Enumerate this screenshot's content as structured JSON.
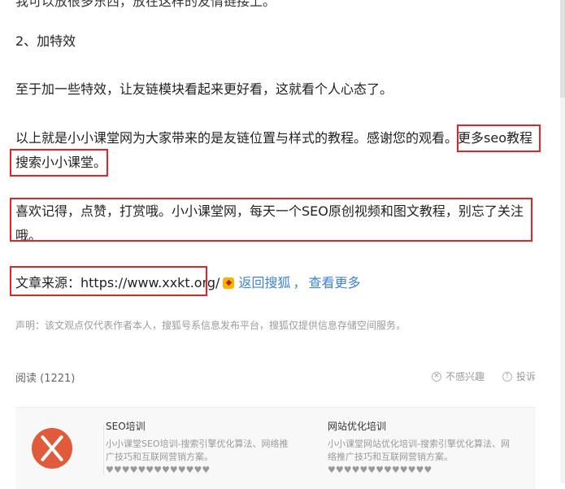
{
  "article": {
    "cut_text": "我可以放很多东西，放在这样的友情链接上。",
    "section_heading": "2、加特效",
    "para_effects": "至于加一些特效，让友链模块看起来更好看，这就看个人心态了。",
    "para_thanks_main": "以上就是小小课堂网为大家带来的是友链位置与样式的教程。感谢您的观看。",
    "para_thanks_more": "更多seo教程",
    "para_thanks_search": "搜索小小课堂。",
    "para_follow_line1": "喜欢记得，点赞，打赏哦。小小课堂网，每天一个SEO原创视频和图文教程，别忘了关注",
    "para_follow_line2": "哦。",
    "source_label": "文章来源：https://www.xxkt.org/",
    "back_link": "返回搜狐",
    "separator": "，",
    "more_link": "查看更多"
  },
  "notice": "声明：该文观点仅代表作者本人，搜狐号系信息发布平台，搜狐仅提供信息存储空间服务。",
  "stats": {
    "reads": "阅读 (1221)",
    "not_interested": "不感兴趣",
    "report": "投诉"
  },
  "cards": [
    {
      "title": "SEO培训",
      "desc": "小小课堂SEO培训-搜索引擎优化算法、网络推广技巧和互联网营销方案。♥♥♥♥♥♥♥♥♥♥♥♥♥"
    },
    {
      "title": "网站优化培训",
      "desc": "小小课堂网站优化培训-搜索引擎优化算法、网络推广技巧和互联网营销方案。♥♥♥♥♥♥♥♥♥♥♥♥♥"
    }
  ],
  "colors": {
    "highlight_border": "#e2232a",
    "link": "#3e82d8",
    "logo": "#e05a3c"
  }
}
